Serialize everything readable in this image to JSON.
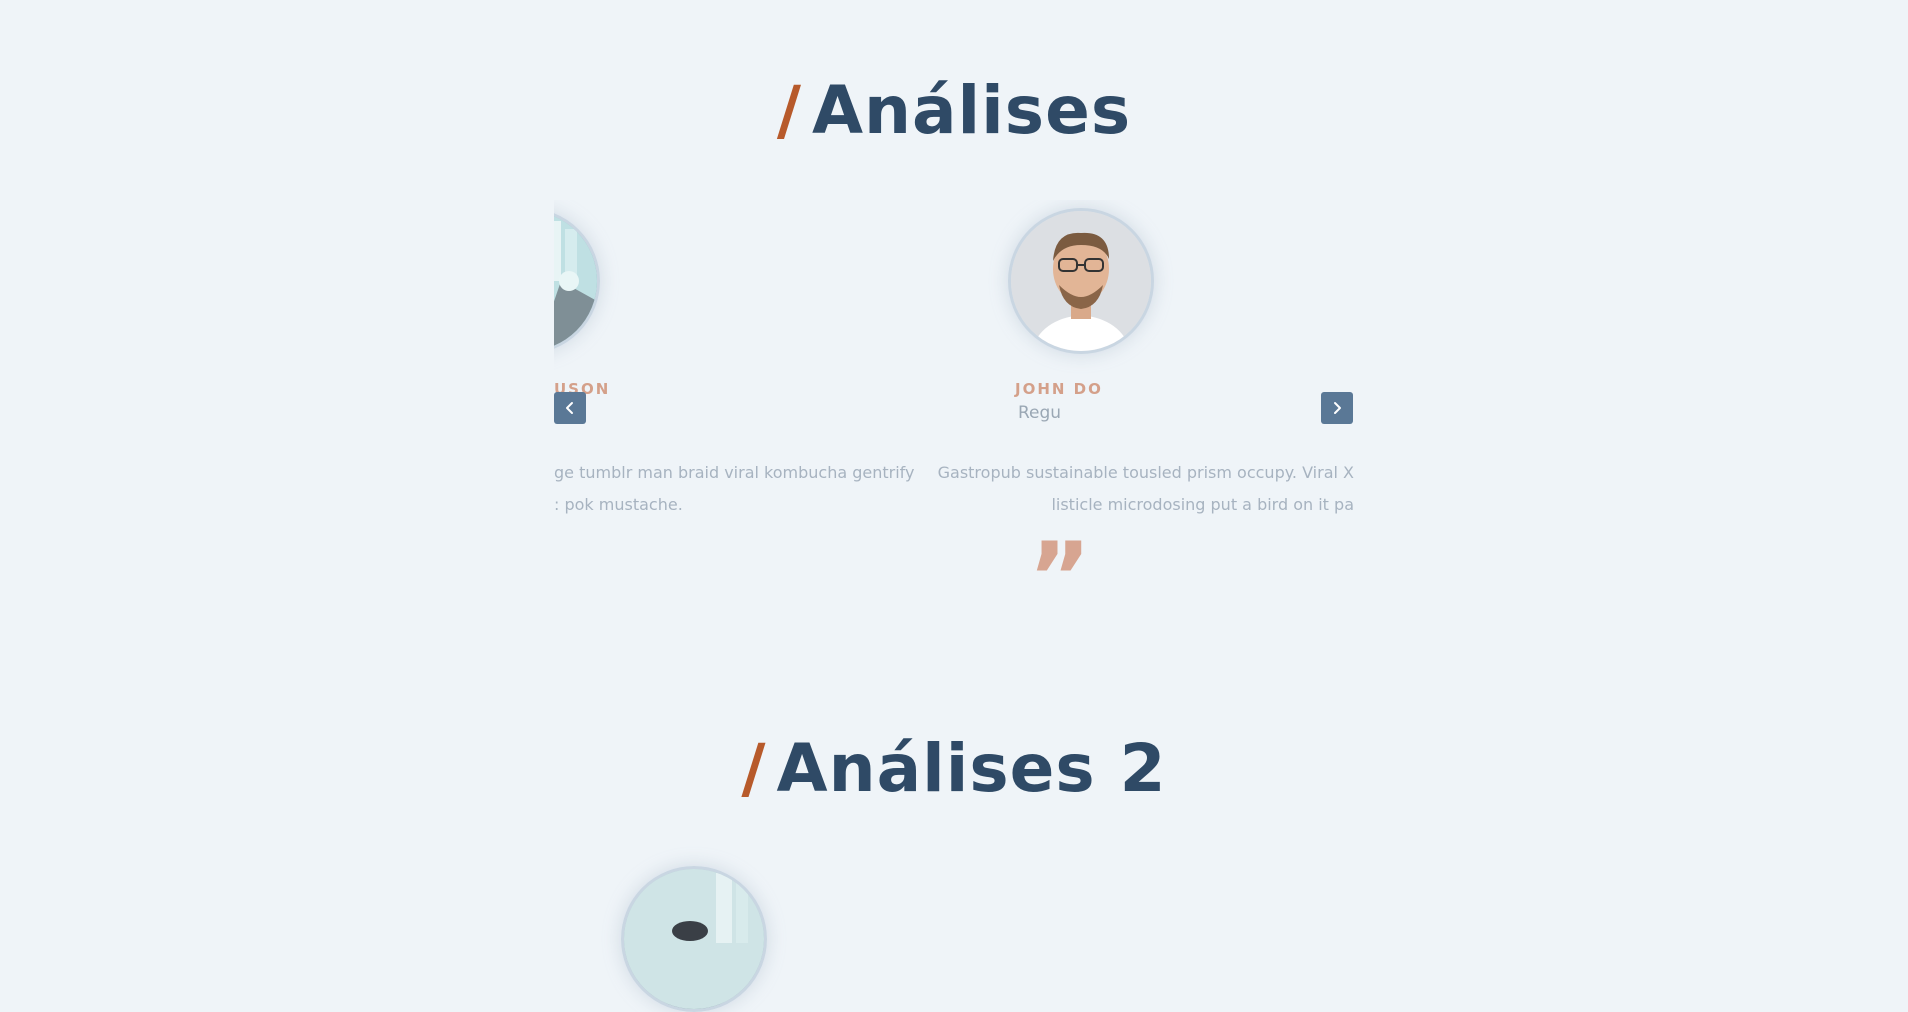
{
  "section1": {
    "slash": "/",
    "title": "Análises",
    "left_name": "USON",
    "left_quote_line1": "ge tumblr man braid viral kombucha gentrify",
    "left_quote_line2": ": pok mustache.",
    "right_name": "JOHN DO",
    "right_role": "Regu",
    "right_quote_line1": "Gastropub sustainable tousled prism occupy. Viral X",
    "right_quote_line2": "listicle microdosing put a bird on it pa",
    "quote_mark": "”"
  },
  "section2": {
    "slash": "/",
    "title": "Análises 2"
  },
  "colors": {
    "background": "#eff4f8",
    "title": "#2f4a66",
    "accent": "#b75a2b",
    "nav_button": "#5a7896"
  },
  "icons": {
    "prev": "chevron-left-icon",
    "next": "chevron-right-icon"
  }
}
